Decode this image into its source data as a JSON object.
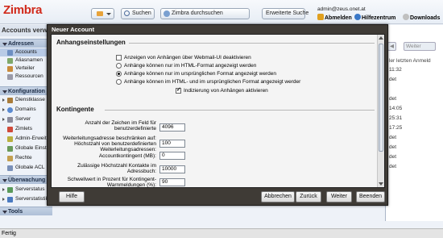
{
  "header": {
    "logo": "Zimbra",
    "search_button": "Suchen",
    "zimbra_search_button": "Zimbra durchsuchen",
    "advanced_search_button": "Erweiterte Suche",
    "user_email": "admin@zeus.onet.at",
    "logout": "Abmelden",
    "help": "Hilfezentrum",
    "downloads": "Downloads"
  },
  "left_panel": {
    "title": "Accounts verwa",
    "sections": [
      {
        "label": "Adressen",
        "items": [
          "Accounts",
          "Aliasnamen",
          "Verteiler",
          "Ressourcen"
        ]
      },
      {
        "label": "Konfiguration",
        "items": [
          "Dienstklasse",
          "Domains",
          "Server",
          "Zimlets",
          "Admin-Erweit",
          "Globale Einstel",
          "Rechte",
          "Globale ACL"
        ]
      },
      {
        "label": "Überwachung",
        "items": [
          "Serverstatus",
          "Serverstatistik"
        ]
      },
      {
        "label": "Tools",
        "items": []
      }
    ]
  },
  "right_panel": {
    "toolbar": [
      "",
      "Weiter"
    ],
    "header": "ler letzten Anmeld",
    "rows": [
      "11:32",
      "det",
      "",
      "det",
      "14:05",
      "25:31",
      "17:25",
      "det",
      "det",
      "det",
      "det"
    ]
  },
  "status_bar": "Fertig",
  "dialog": {
    "title": "Neuer Account",
    "section_attachments": "Anhangseinstellungen",
    "attachment_options": [
      {
        "label": "Anzeigen von Anhängen über Webmail-UI deaktivieren",
        "type": "checkbox",
        "checked": false
      },
      {
        "label": "Anhänge können nur im HTML-Format angezeigt werden",
        "type": "radio",
        "checked": false
      },
      {
        "label": "Anhänge können nur im ursprünglichen Format angezeigt werden",
        "type": "radio",
        "checked": true
      },
      {
        "label": "Anhänge können im HTML- und im ursprünglichen Format angezeigt werder",
        "type": "radio",
        "checked": false
      },
      {
        "label": "Indizierung von Anhängen aktivieren",
        "type": "checkbox",
        "checked": true
      }
    ],
    "section_quotas": "Kontingente",
    "quota_fields": [
      {
        "label": "Anzahl der Zeichen im Feld für benutzerdefinierte",
        "value": "4096"
      },
      {
        "label": "Weiterleitungsadresse beschränken auf: Höchstzahl von benutzerdefinierten Weiterleitungsadressen:",
        "value": "100"
      },
      {
        "label": "Accountkontingent (MB):",
        "value": "0"
      },
      {
        "label": "Zulässige Höchstzahl Kontakte im Adressbuch:",
        "value": "10000"
      },
      {
        "label": "Schwellwert in Prozent für Kontingent-Warnmeldungen (%):",
        "value": "90"
      }
    ],
    "buttons": {
      "help": "Hilfe",
      "cancel": "Abbrechen",
      "back": "Zurück",
      "next": "Weiter",
      "finish": "Beenden"
    }
  },
  "colors": {
    "accent": "#d12a1b",
    "dialog_frame": "#3f3b36",
    "section_header": "#b5c5dc"
  }
}
